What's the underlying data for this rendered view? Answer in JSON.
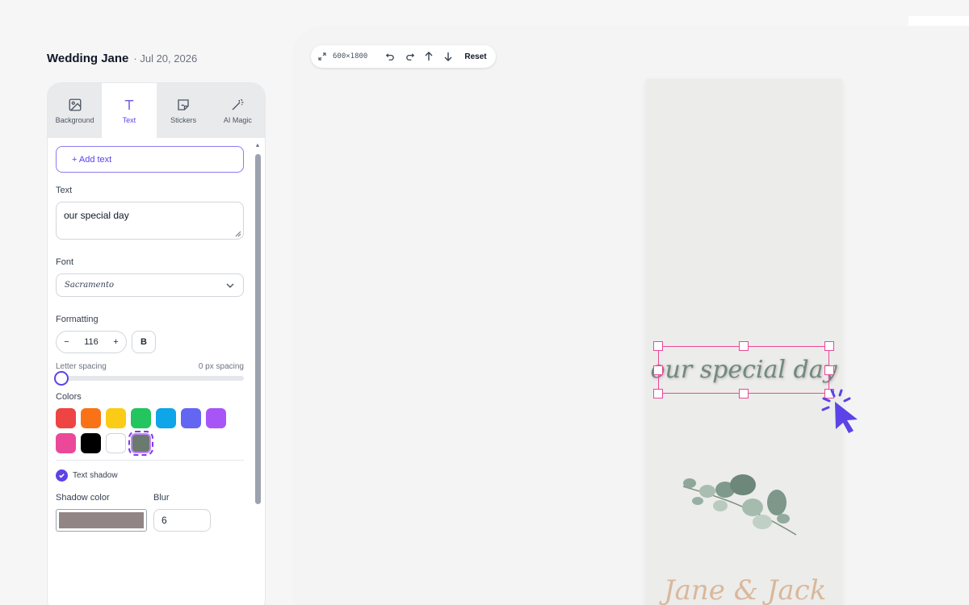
{
  "project": {
    "name": "Wedding Jane",
    "date": "· Jul 20, 2026"
  },
  "tabs": [
    {
      "label": "Background",
      "icon": "image-icon"
    },
    {
      "label": "Text",
      "icon": "text-icon",
      "active": true
    },
    {
      "label": "Stickers",
      "icon": "sticker-icon"
    },
    {
      "label": "AI Magic",
      "icon": "magic-wand-icon"
    }
  ],
  "text_panel": {
    "add_text_label": "+ Add text",
    "text_label": "Text",
    "text_value": "our special day",
    "font_label": "Font",
    "font_value": "Sacramento",
    "formatting_label": "Formatting",
    "font_size": "116",
    "minus": "−",
    "plus": "+",
    "bold_label": "B",
    "letter_spacing_label": "Letter spacing",
    "letter_spacing_value": "0 px spacing",
    "letter_spacing": 0,
    "colors_label": "Colors",
    "colors": [
      "#ef4444",
      "#f97316",
      "#facc15",
      "#22c55e",
      "#0ea5e9",
      "#6366f1",
      "#a855f7",
      "#ec4899",
      "#000000",
      "#ffffff",
      "#6b7a6f"
    ],
    "selected_color": "#6b7a6f",
    "shadow_label": "Text shadow",
    "shadow_enabled": true,
    "shadow_color_label": "Shadow color",
    "shadow_color": "#918585",
    "blur_label": "Blur",
    "blur_value": "6"
  },
  "toolbar": {
    "dimensions": "600×1800",
    "reset_label": "Reset"
  },
  "canvas": {
    "text": "our special day",
    "names": "Jane & Jack"
  },
  "accent_color": "#5b43e8"
}
